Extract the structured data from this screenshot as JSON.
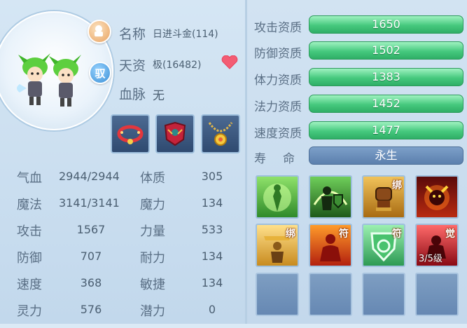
{
  "pet": {
    "name_label": "名称",
    "name_value": "日进斗金(114)",
    "talent_label": "天资",
    "talent_value": "极(16482)",
    "bloodline_label": "血脉",
    "bloodline_value": "无",
    "tame_badge": "驭",
    "face_icon": "lock-face-icon",
    "favorite_icon": "heart-icon"
  },
  "equipment": [
    {
      "icon": "red-collar-icon"
    },
    {
      "icon": "red-armor-icon"
    },
    {
      "icon": "gold-amulet-icon"
    }
  ],
  "stats": [
    {
      "label": "气血",
      "value": "2944/2944",
      "label2": "体质",
      "value2": "305"
    },
    {
      "label": "魔法",
      "value": "3141/3141",
      "label2": "魔力",
      "value2": "134"
    },
    {
      "label": "攻击",
      "value": "1567",
      "label2": "力量",
      "value2": "533"
    },
    {
      "label": "防御",
      "value": "707",
      "label2": "耐力",
      "value2": "134"
    },
    {
      "label": "速度",
      "value": "368",
      "label2": "敏捷",
      "value2": "134"
    },
    {
      "label": "灵力",
      "value": "576",
      "label2": "潜力",
      "value2": "0"
    }
  ],
  "aptitudes": [
    {
      "label": "攻击资质",
      "value": "1650"
    },
    {
      "label": "防御资质",
      "value": "1502"
    },
    {
      "label": "体力资质",
      "value": "1383"
    },
    {
      "label": "法力资质",
      "value": "1452"
    },
    {
      "label": "速度资质",
      "value": "1477"
    }
  ],
  "lifespan": {
    "label": "寿命",
    "value": "永生"
  },
  "skills": [
    {
      "icon": "green-aura-skill-icon",
      "tag": "",
      "level": ""
    },
    {
      "icon": "shield-warrior-skill-icon",
      "tag": "",
      "level": ""
    },
    {
      "icon": "fist-skill-icon",
      "tag": "绑",
      "level": ""
    },
    {
      "icon": "demon-skill-icon",
      "tag": "",
      "level": ""
    },
    {
      "icon": "golden-monk-skill-icon",
      "tag": "绑",
      "level": ""
    },
    {
      "icon": "red-figure-skill-icon",
      "tag": "符",
      "level": ""
    },
    {
      "icon": "green-shield-skill-icon",
      "tag": "符",
      "level": ""
    },
    {
      "icon": "red-awaken-skill-icon",
      "tag": "觉",
      "level": "3/5级"
    }
  ],
  "colors": {
    "aptitude_bar": "#46c97e",
    "lifespan_bar": "#5b7fad",
    "label_text": "#5a6f85"
  }
}
